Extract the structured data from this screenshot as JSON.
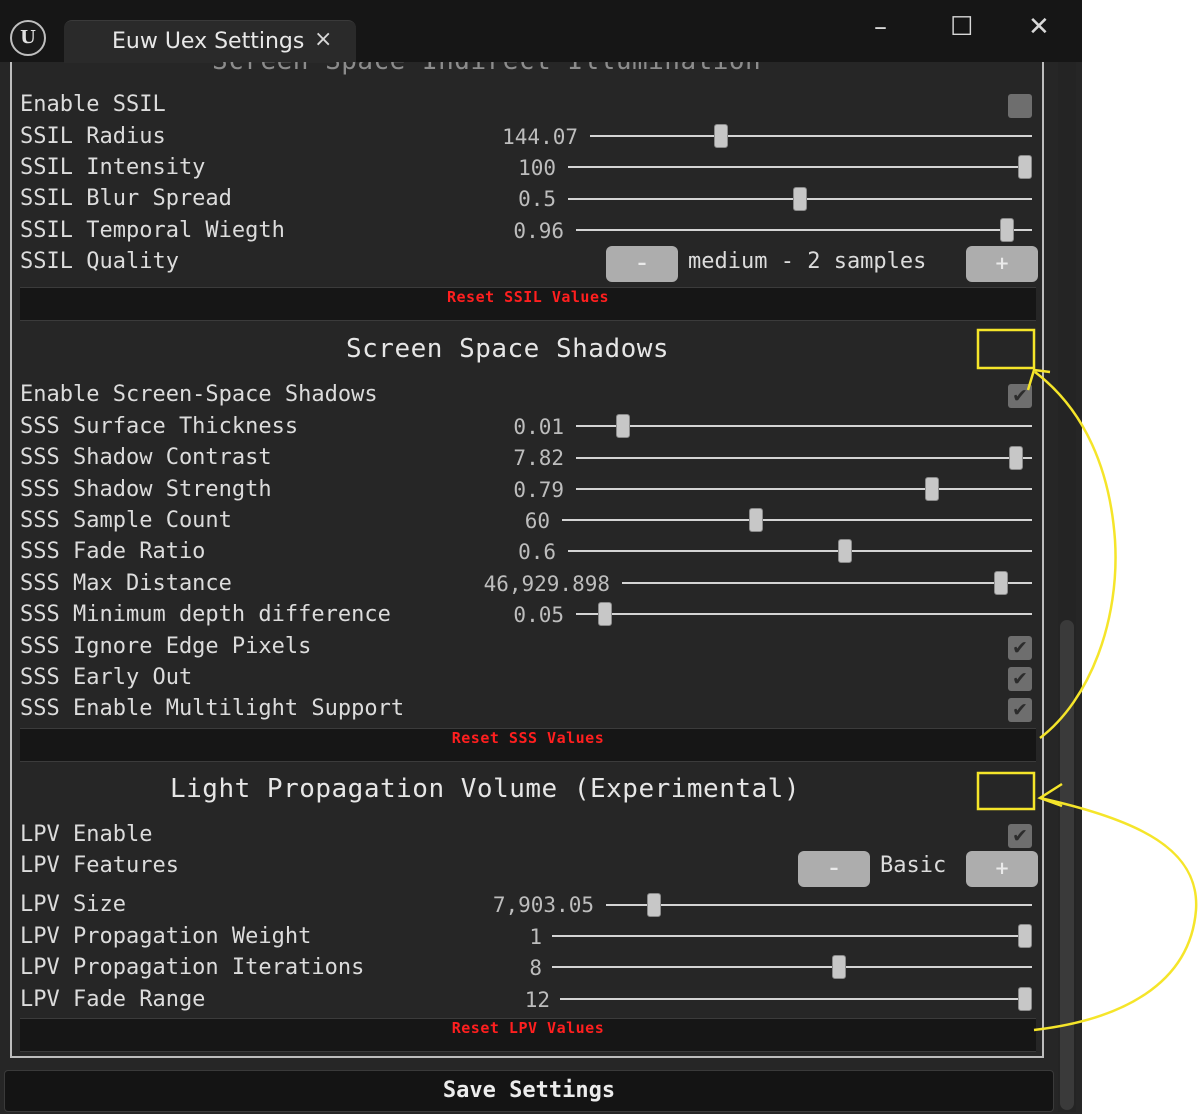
{
  "window": {
    "tab_title": "Euw Uex Settings",
    "tab_close": "×",
    "minimize": "–",
    "maximize": "☐",
    "close": "✕",
    "logo": "U"
  },
  "ssil": {
    "header": "Screen Space Indirect Illumination",
    "enable_label": "Enable SSIL",
    "enable_checked": false,
    "radius": {
      "label": "SSIL Radius",
      "value_text": "144.07",
      "fraction": 0.29
    },
    "intensity": {
      "label": "SSIL Intensity",
      "value_text": "100",
      "fraction": 1.0
    },
    "blur": {
      "label": "SSIL Blur Spread",
      "value_text": "0.5",
      "fraction": 0.5
    },
    "temporal": {
      "label": "SSIL Temporal Wiegth",
      "value_text": "0.96",
      "fraction": 0.96
    },
    "quality": {
      "label": "SSIL Quality",
      "value": "medium - 2 samples",
      "minus": "–",
      "plus": "+"
    },
    "reset_label": "Reset SSIL Values"
  },
  "sss": {
    "header": "Screen Space Shadows",
    "enable_label": "Enable Screen-Space Shadows",
    "enable_checked": true,
    "thickness": {
      "label": "SSS Surface Thickness",
      "value_text": "0.01",
      "fraction": 0.09
    },
    "contrast": {
      "label": "SSS Shadow Contrast",
      "value_text": "7.82",
      "fraction": 0.98
    },
    "strength": {
      "label": "SSS Shadow Strength",
      "value_text": "0.79",
      "fraction": 0.79
    },
    "sample_count": {
      "label": "SSS Sample Count",
      "value_text": "60",
      "fraction": 0.41
    },
    "fade_ratio": {
      "label": "SSS Fade Ratio",
      "value_text": "0.6",
      "fraction": 0.6
    },
    "max_distance": {
      "label": "SSS Max Distance",
      "value_text": "46,929.898",
      "fraction": 0.94
    },
    "min_depth": {
      "label": "SSS Minimum depth difference",
      "value_text": "0.05",
      "fraction": 0.05
    },
    "ignore_edge": {
      "label": "SSS Ignore Edge Pixels",
      "checked": true
    },
    "early_out": {
      "label": "SSS Early Out",
      "checked": true
    },
    "multilight": {
      "label": "SSS Enable Multilight Support",
      "checked": true
    },
    "reset_label": "Reset SSS Values"
  },
  "lpv": {
    "header": "Light Propagation Volume (Experimental)",
    "enable_label": "LPV Enable",
    "enable_checked": true,
    "features": {
      "label": "LPV Features",
      "value": "Basic",
      "minus": "–",
      "plus": "+"
    },
    "size": {
      "label": "LPV Size",
      "value_text": "7,903.05",
      "fraction": 0.1
    },
    "weight": {
      "label": "LPV Propagation Weight",
      "value_text": "1",
      "fraction": 1.0
    },
    "iterations": {
      "label": "LPV Propagation Iterations",
      "value_text": "8",
      "fraction": 0.6
    },
    "fade_range": {
      "label": "LPV Fade Range",
      "value_text": "12",
      "fraction": 1.0
    },
    "reset_label": "Reset LPV Values"
  },
  "save_label": "Save Settings",
  "colors": {
    "annotation": "#f5e52a",
    "reset_text": "#ff1f1f",
    "background": "#262626"
  }
}
